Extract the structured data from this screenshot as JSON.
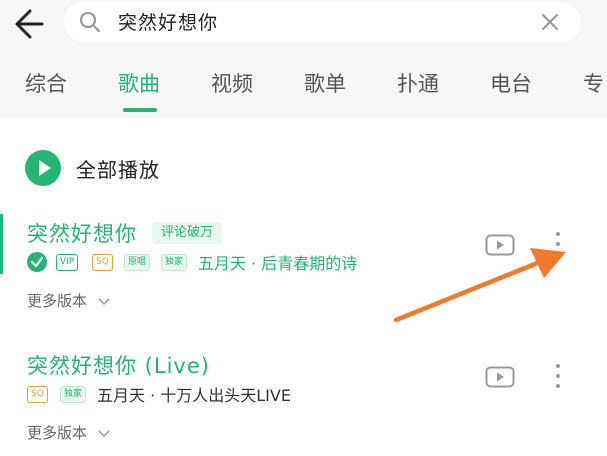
{
  "search": {
    "query": "突然好想你"
  },
  "tabs": [
    {
      "label": "综合"
    },
    {
      "label": "歌曲"
    },
    {
      "label": "视频"
    },
    {
      "label": "歌单"
    },
    {
      "label": "扑通"
    },
    {
      "label": "电台"
    },
    {
      "label": "专"
    }
  ],
  "active_tab": "歌曲",
  "play_all": {
    "label": "全部播放"
  },
  "songs": [
    {
      "title": "突然好想你",
      "hot_tag": "评论破万",
      "badges": [
        "VIP",
        "SQ",
        "原唱",
        "独家"
      ],
      "meta": "五月天 · 后青春期的诗",
      "more_versions": "更多版本"
    },
    {
      "title": "突然好想你 (Live)",
      "badges": [
        "SQ",
        "独家"
      ],
      "meta": "五月天 · 十万人出头天LIVE",
      "more_versions": "更多版本"
    }
  ],
  "colors": {
    "accent": "#22b573",
    "sq": "#e6a23c",
    "annotation_arrow": "#f07a2a"
  },
  "icons": [
    "back-arrow-icon",
    "search-icon",
    "clear-icon",
    "play-icon",
    "check-icon",
    "mv-play-icon",
    "more-vertical-icon",
    "chevron-down-icon"
  ]
}
